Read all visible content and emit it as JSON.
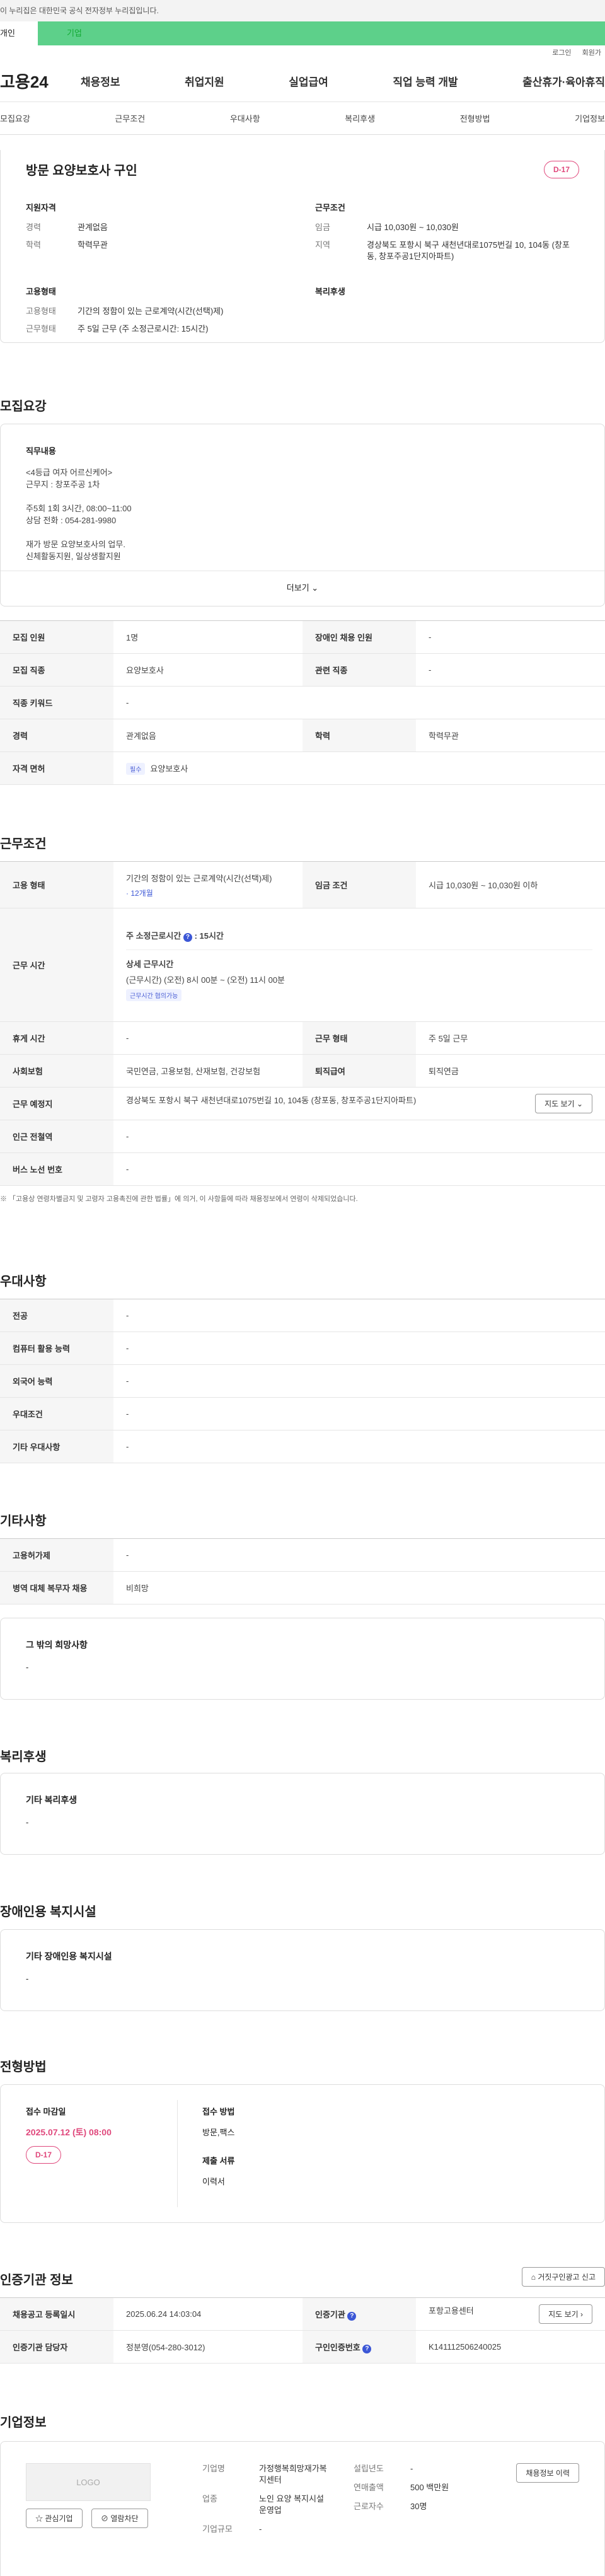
{
  "banner": "이 누리집은 대한민국 공식 전자정부 누리집입니다.",
  "topbar": {
    "tab_personal": "개인",
    "tab_company": "기업"
  },
  "util": {
    "login": "로그인",
    "join": "회원가"
  },
  "gnb": {
    "logo": "고용24",
    "menu": [
      "채용정보",
      "취업지원",
      "실업급여",
      "직업 능력 개발",
      "출산휴가·육아휴직"
    ]
  },
  "subnav": [
    "모집요강",
    "근무조건",
    "우대사항",
    "복리후생",
    "전형방법",
    "기업정보"
  ],
  "summary": {
    "title": "방문 요양보호사 구인",
    "dday": "D-17",
    "qual_title": "지원자격",
    "qual": [
      {
        "k": "경력",
        "v": "관계없음"
      },
      {
        "k": "학력",
        "v": "학력무관"
      }
    ],
    "cond_title": "근무조건",
    "cond": [
      {
        "k": "임금",
        "v": "시급 10,030원 ~ 10,030원"
      },
      {
        "k": "지역",
        "v": "경상북도 포항시 북구 새천년대로1075번길 10, 104동 (창포동, 창포주공1단지아파트)"
      }
    ],
    "emp_title": "고용형태",
    "emp": [
      {
        "k": "고용형태",
        "v": "기간의 정함이 있는 근로계약(시간(선택)제)"
      },
      {
        "k": "근무형태",
        "v": "주 5일 근무 (주 소정근로시간: 15시간)"
      }
    ],
    "welfare_title": "복리후생"
  },
  "recruit": {
    "title": "모집요강",
    "duty_title": "직무내용",
    "duty_lines": [
      "<4등급 여자 어르신케어>",
      "근무지 : 창포주공 1차",
      "",
      "주5회  1회  3시간,  08:00~11:00",
      "상담 전화  : 054-281-9980",
      "",
      "재가 방문 요양보호사의 업무.",
      "신체활동지원, 일상생활지원"
    ],
    "more": "더보기",
    "rows": [
      {
        "k1": "모집 인원",
        "v1": "1명",
        "k2": "장애인 채용 인원",
        "v2": "-"
      },
      {
        "k1": "모집 직종",
        "v1": "요양보호사",
        "k2": "관련 직종",
        "v2": "-"
      },
      {
        "k1": "직종 키워드",
        "v1": "-"
      },
      {
        "k1": "경력",
        "v1": "관계없음",
        "k2": "학력",
        "v2": "학력무관"
      },
      {
        "k1": "자격 면허",
        "tag": "필수",
        "v1": "요양보호사"
      }
    ]
  },
  "work": {
    "title": "근무조건",
    "emp_type_k": "고용 형태",
    "emp_type_v": "기간의 정함이 있는 근로계약(시간(선택)제)",
    "emp_period": "· 12개월",
    "wage_k": "임금 조건",
    "wage_v": "시급 10,030원 ~ 10,030원 이하",
    "hours_k": "근무 시간",
    "hours_main": "주 소정근로시간",
    "hours_main_v": "15시간",
    "hours_detail_title": "상세 근무시간",
    "hours_detail_v": "(근무시간) (오전) 8시 00분 ~ (오전) 11시 00분",
    "hours_tag": "근무시간 협의가능",
    "rest_k": "휴게 시간",
    "rest_v": "-",
    "form_k": "근무 형태",
    "form_v": "주 5일 근무",
    "ins_k": "사회보험",
    "ins_v": "국민연금, 고용보험, 산재보험, 건강보험",
    "sev_k": "퇴직급여",
    "sev_v": "퇴직연금",
    "place_k": "근무 예정지",
    "place_v": "경상북도 포항시 북구 새천년대로1075번길 10, 104동 (창포동, 창포주공1단지아파트)",
    "map_btn": "지도 보기",
    "subway_k": "인근 전철역",
    "subway_v": "-",
    "bus_k": "버스 노선 번호",
    "bus_v": "-",
    "notice": "※ 「고용상 연령차별금지 및 고령자 고용촉진에 관한 법률」에 의거, 이 사항들에 따라 채용정보에서 연령이 삭제되었습니다."
  },
  "pref": {
    "title": "우대사항",
    "rows": [
      {
        "k": "전공",
        "v": "-"
      },
      {
        "k": "컴퓨터 활용 능력",
        "v": "-"
      },
      {
        "k": "외국어 능력",
        "v": "-"
      },
      {
        "k": "우대조건",
        "v": "-"
      },
      {
        "k": "기타 우대사항",
        "v": "-"
      }
    ]
  },
  "etc": {
    "title": "기타사항",
    "rows": [
      {
        "k": "고용허가제",
        "v": "-"
      },
      {
        "k": "병역 대체 복무자 채용",
        "v": "비희망"
      }
    ],
    "other_title": "그 밖의 희망사항",
    "other_v": "-"
  },
  "welfare": {
    "title": "복리후생",
    "sub": "기타 복리후생",
    "v": "-"
  },
  "disabled": {
    "title": "장애인용 복지시설",
    "sub": "기타 장애인용 복지시설",
    "v": "-"
  },
  "screening": {
    "title": "전형방법",
    "deadline_title": "접수 마감일",
    "deadline": "2025.07.12 (토) 08:00",
    "dday": "D-17",
    "method_title": "접수 방법",
    "method": "방문,팩스",
    "docs_title": "제출 서류",
    "docs": "이력서"
  },
  "agency": {
    "title": "인증기관 정보",
    "report_btn": "거짓구인광고 신고",
    "rows": [
      {
        "k1": "채용공고 등록일시",
        "v1": "2025.06.24 14:03:04",
        "k2": "인증기관",
        "v2": "포항고용센터",
        "btn": "지도 보기"
      },
      {
        "k1": "인증기관 담당자",
        "v1": "정분영(054-280-3012)",
        "k2": "구인인증번호",
        "v2": "K141112506240025"
      }
    ]
  },
  "company": {
    "title": "기업정보",
    "logo": "LOGO",
    "fav_btn": "관심기업",
    "block_btn": "열람차단",
    "fields": [
      {
        "k": "기업명",
        "v": "가정행복희망재가복지센터"
      },
      {
        "k": "업종",
        "v": "노인 요양 복지시설 운영업"
      },
      {
        "k": "기업규모",
        "v": "-"
      }
    ],
    "fields2": [
      {
        "k": "설립년도",
        "v": "-"
      },
      {
        "k": "연매출액",
        "v": "500 백만원"
      },
      {
        "k": "근로자수",
        "v": "30명"
      }
    ],
    "history_btn": "채용정보 이력"
  }
}
